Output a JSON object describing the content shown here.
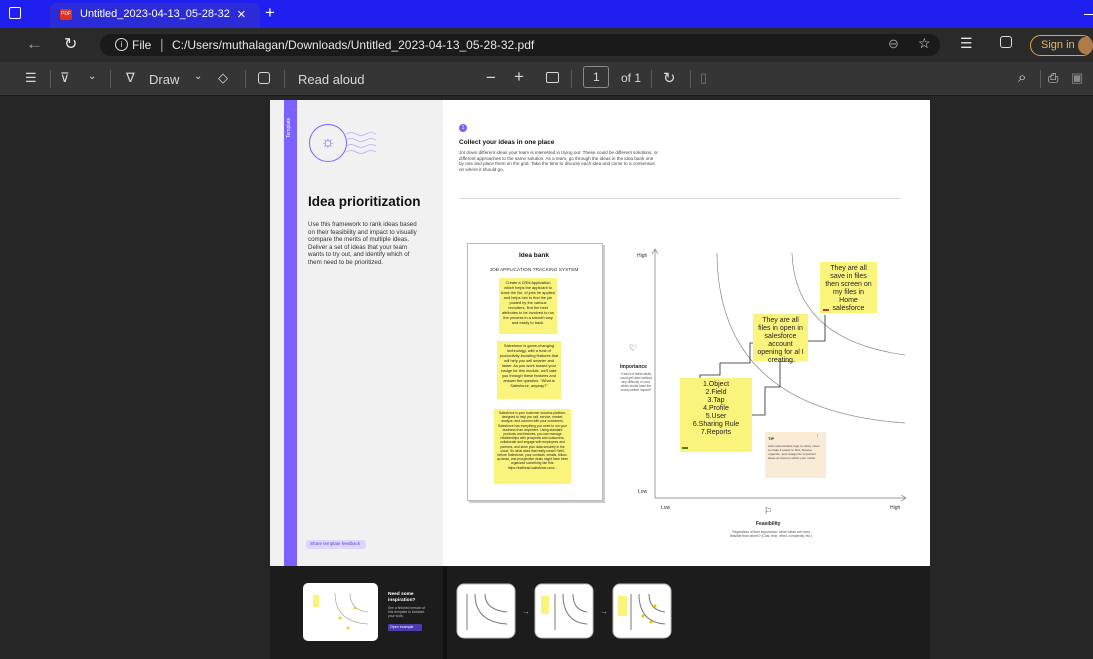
{
  "browser": {
    "tab_title": "Untitled_2023-04-13_05-28-32.p",
    "tab_close": "×",
    "new_tab": "+",
    "file_label": "File",
    "url": "C:/Users/muthalagan/Downloads/Untitled_2023-04-13_05-28-32.pdf",
    "sign_in": "Sign in"
  },
  "toolbar": {
    "draw_label": "Draw",
    "read_aloud": "Read aloud",
    "page_current": "1",
    "page_total": "of 1",
    "minus": "−",
    "plus": "+"
  },
  "doc": {
    "template_tag": "Template",
    "title": "Idea prioritization",
    "description": "Use this framework to rank ideas based on their feasibility and impact to visually compare the merits of multiple ideas. Deliver a set of ideas that your team wants to try out, and identify which of them need to be prioritized.",
    "feedback_button": "Share template feedback",
    "step_number": "1",
    "step_title": "Collect your ideas in one place",
    "step_text": "Jot down different ideas your team is interested in trying out. These could be different solutions, or different approaches to the same solution. As a team, go through the ideas in the idea bank one by one and place them on the grid. Take the time to discuss each idea and come to a consensus on where it should go.",
    "idea_bank": {
      "title": "Idea bank",
      "subtitle": "JOB APPLICATION TRACKING SYSTEM",
      "notes": [
        "Create a CRM Application which helps the applicant to track the No. of jobs he applied and helps him to find the job posted by the various recruiters, find the best attributes to be involved to run the process in a smooth way and easily to track.",
        "Salesforce is game-changing technology, with a host of productivity-boosting features that will help you sell smarter and faster. As you work toward your badge for this module, we'll take you through these features and answer the question, \"What is Salesforce, anyway?\"",
        "Salesforce is your customer success platform, designed to help you sell, service, market, analyze, and connect with your customers. Salesforce has everything you need to run your business from anywhere. Using standard products and features, you can manage relationships with prospects and customers, collaborate and engage with employees and partners, and store your data securely in the cloud. So what does that really mean? Well, before Salesforce, your contacts, emails, follow-up tasks, and prospective deals might have been organized something like this: https://trailhead.salesforce.com/..."
      ]
    },
    "grid": {
      "y_high": "High",
      "y_low": "Low",
      "x_low": "Low",
      "x_high": "High",
      "importance_label": "Importance",
      "importance_desc": "If each of these tasks could get done without any difficulty or cost, which would have the most positive impact?",
      "feasibility_label": "Feasibility",
      "feasibility_desc": "Regardless of their importance, which tasks are most feasible than others? (Cost, time, effort, complexity, etc.)",
      "note_bottom_lines": [
        "1.Object",
        "2.Field",
        "3.Tap",
        "4.Profile",
        "5.User",
        "6.Sharing Rule",
        "7.Reports"
      ],
      "note_middle": "They are all files in open in salesforce account opening for al I creating",
      "note_top": "They are all save in files then screen on my files in Home salesforce",
      "tip_title": "TIP",
      "tip_text": "Add customizable tags to sticky notes to make it easier to find, browse, organize, and categorize important ideas as themes within your mural."
    },
    "inspiration": {
      "title": "Need some inspiration?",
      "text": "See a finished version of this template to kickstart your work.",
      "button": "Open example"
    }
  },
  "colors": {
    "accent": "#7b61ff",
    "sticky": "#fbf47c",
    "titlebar": "#1f1ff0"
  }
}
